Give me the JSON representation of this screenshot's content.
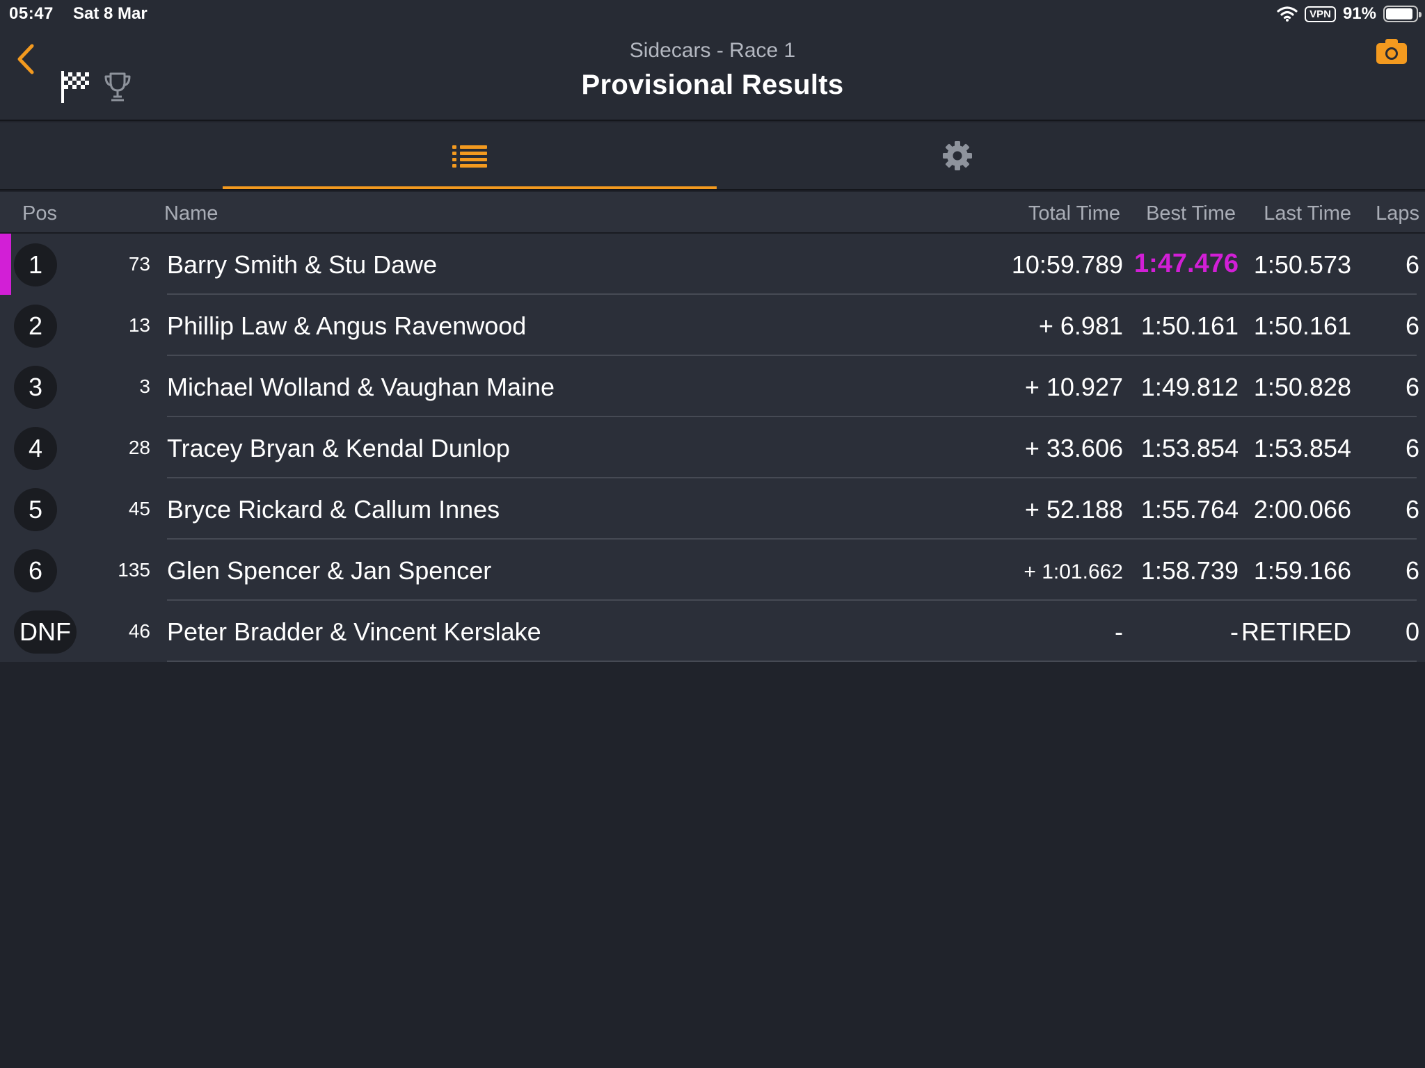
{
  "status_bar": {
    "time": "05:47",
    "date": "Sat 8 Mar",
    "vpn": "VPN",
    "battery": "91%",
    "battery_level": 0.91
  },
  "header": {
    "subtitle": "Sidecars - Race 1",
    "title": "Provisional Results"
  },
  "colors": {
    "accent": "#f39a1f",
    "fastest_lap": "#d21fd6",
    "background": "#20232b"
  },
  "icons": {
    "back": "chevron-left-icon",
    "flag": "checkered-flag-icon",
    "trophy": "trophy-icon",
    "camera": "camera-icon",
    "list": "list-icon",
    "settings": "gear-icon"
  },
  "table": {
    "headers": {
      "pos": "Pos",
      "name": "Name",
      "total": "Total Time",
      "best": "Best Time",
      "last": "Last Time",
      "laps": "Laps"
    },
    "rows": [
      {
        "pos": "1",
        "number": "73",
        "name": "Barry Smith & Stu Dawe",
        "total": "10:59.789",
        "best": "1:47.476",
        "last": "1:50.573",
        "laps": "6",
        "fastest_lap": true
      },
      {
        "pos": "2",
        "number": "13",
        "name": "Phillip Law & Angus Ravenwood",
        "total": "+ 6.981",
        "best": "1:50.161",
        "last": "1:50.161",
        "laps": "6"
      },
      {
        "pos": "3",
        "number": "3",
        "name": "Michael Wolland & Vaughan Maine",
        "total": "+ 10.927",
        "best": "1:49.812",
        "last": "1:50.828",
        "laps": "6"
      },
      {
        "pos": "4",
        "number": "28",
        "name": "Tracey Bryan & Kendal Dunlop",
        "total": "+ 33.606",
        "best": "1:53.854",
        "last": "1:53.854",
        "laps": "6"
      },
      {
        "pos": "5",
        "number": "45",
        "name": "Bryce Rickard & Callum Innes",
        "total": "+ 52.188",
        "best": "1:55.764",
        "last": "2:00.066",
        "laps": "6"
      },
      {
        "pos": "6",
        "number": "135",
        "name": "Glen Spencer & Jan Spencer",
        "total": "+ 1:01.662",
        "best": "1:58.739",
        "last": "1:59.166",
        "laps": "6"
      },
      {
        "pos": "DNF",
        "number": "46",
        "name": "Peter Bradder & Vincent Kerslake",
        "total": "-",
        "best": "-",
        "last": "RETIRED",
        "laps": "0"
      }
    ]
  }
}
